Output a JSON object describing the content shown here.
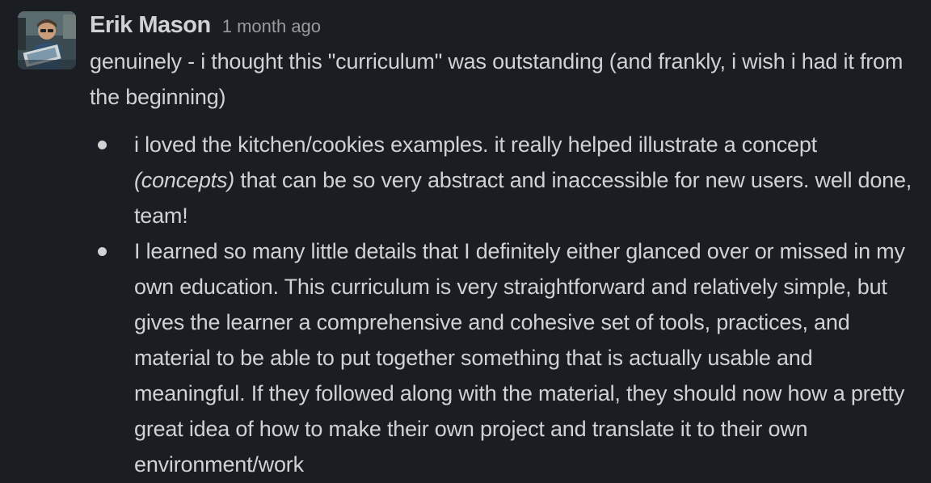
{
  "message": {
    "author": "Erik Mason",
    "timestamp": "1 month ago",
    "avatar": {
      "icon": "user-avatar-photo"
    },
    "intro": "genuinely - i thought this \"curriculum\" was outstanding (and frankly, i wish i had it from the beginning)",
    "bullets": [
      {
        "before": "i loved the kitchen/cookies examples. it really helped illustrate a concept ",
        "italic": "(concepts)",
        "after": " that can be so very abstract and inaccessible for new users. well done, team!"
      },
      {
        "text": "I learned so many little details that I definitely either glanced over or missed in my own education. This curriculum is very straightforward and relatively simple, but gives the learner a comprehensive and cohesive set of tools, practices, and material to be able to put together something that is actually usable and meaningful. If they followed along with the material, they should now how a pretty great idea of how to make their own project and translate it to their own environment/work"
      }
    ]
  },
  "colors": {
    "background": "#1a1d21",
    "text": "#d1d2d3",
    "muted": "#9a9b9d"
  }
}
